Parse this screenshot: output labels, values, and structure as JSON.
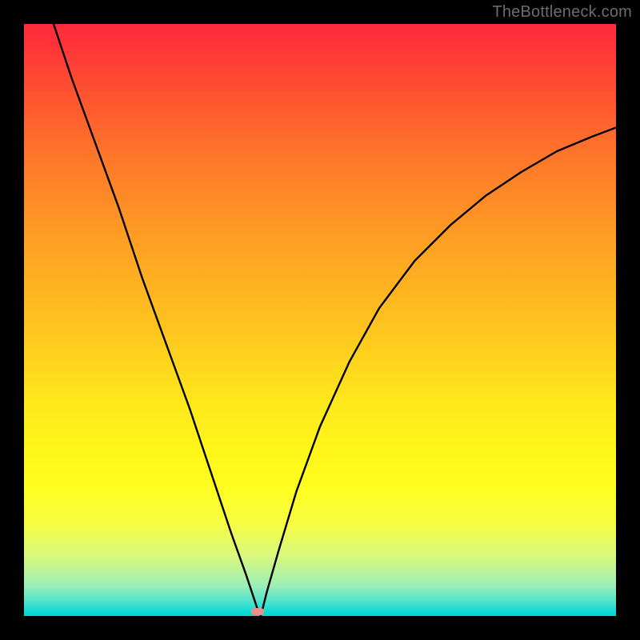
{
  "watermark": "TheBottleneck.com",
  "marker": {
    "color": "#e8908c"
  },
  "chart_data": {
    "type": "line",
    "title": "",
    "xlabel": "",
    "ylabel": "",
    "x_range": [
      0,
      100
    ],
    "y_range": [
      0,
      100
    ],
    "grid": false,
    "legend": false,
    "series": [
      {
        "name": "bottleneck-curve",
        "x": [
          5,
          8,
          12,
          16,
          20,
          24,
          28,
          32,
          35,
          37.5,
          39,
          39.5,
          40,
          41,
          43,
          46,
          50,
          55,
          60,
          66,
          72,
          78,
          84,
          90,
          96,
          100
        ],
        "y": [
          100,
          91,
          80,
          69,
          57,
          46,
          35,
          23,
          14,
          7,
          2.5,
          1,
          0,
          4,
          11,
          21,
          32,
          43,
          52,
          60,
          66,
          71,
          75,
          78.5,
          81,
          82.5
        ]
      }
    ],
    "gradient_stops": [
      {
        "pos": 0.0,
        "color": "#fe2a3b"
      },
      {
        "pos": 0.1,
        "color": "#fe4c31"
      },
      {
        "pos": 0.22,
        "color": "#fe752a"
      },
      {
        "pos": 0.37,
        "color": "#fea023"
      },
      {
        "pos": 0.52,
        "color": "#fec61e"
      },
      {
        "pos": 0.64,
        "color": "#fee81b"
      },
      {
        "pos": 0.78,
        "color": "#fffd1e"
      },
      {
        "pos": 0.9,
        "color": "#d8f87e"
      },
      {
        "pos": 0.98,
        "color": "#41e1ce"
      },
      {
        "pos": 1.0,
        "color": "#00d6d3"
      }
    ],
    "marker_x": 39.5
  }
}
